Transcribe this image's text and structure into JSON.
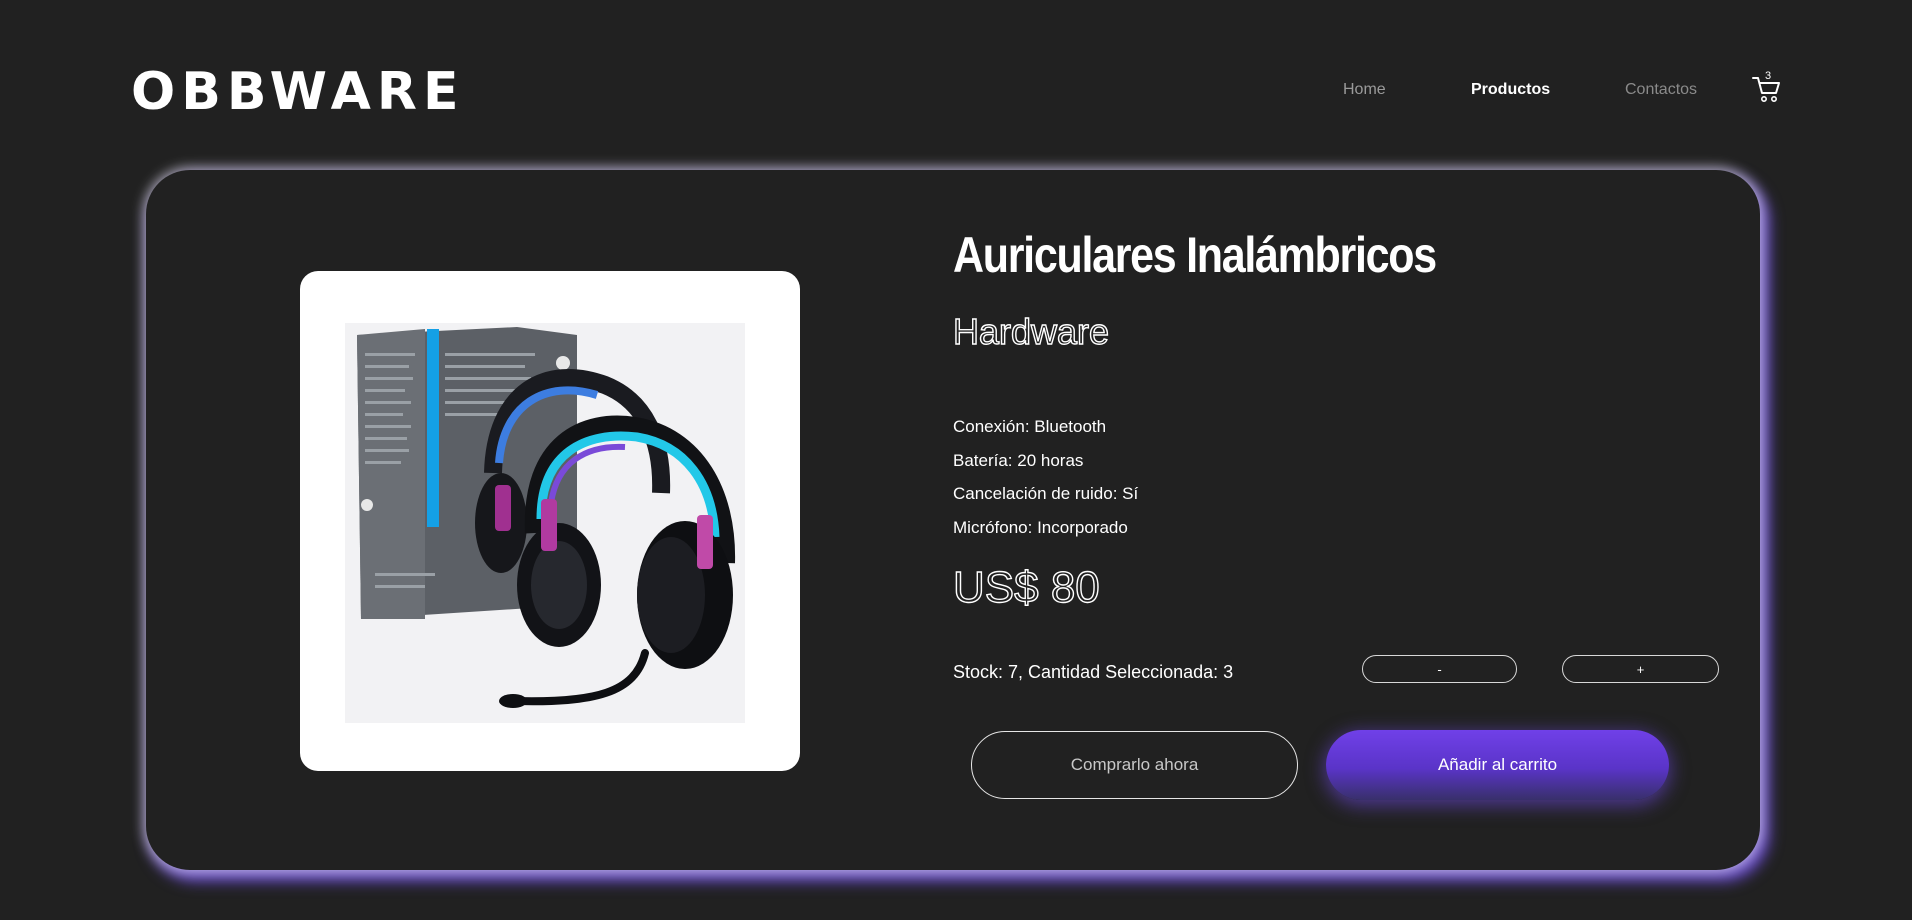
{
  "header": {
    "logo": "OBBWARE",
    "nav": [
      {
        "label": "Home"
      },
      {
        "label": "Productos"
      },
      {
        "label": "Contactos"
      }
    ],
    "cart_count": "3"
  },
  "product": {
    "title": "Auriculares Inalámbricos",
    "category": "Hardware",
    "specs": [
      "Conexión: Bluetooth",
      "Batería: 20 horas",
      "Cancelación de ruido: Sí",
      "Micrófono: Incorporado"
    ],
    "price": "US$ 80",
    "stock_text": "Stock: 7, Cantidad Seleccionada: 3",
    "qty_minus_label": "-",
    "qty_plus_label": "+",
    "buy_now_label": "Comprarlo ahora",
    "add_to_cart_label": "Añadir al carrito"
  },
  "colors": {
    "background": "#212121",
    "accent": "#6a44e0",
    "card_glow": "#7050e0"
  },
  "icons": {
    "cart": "cart-icon",
    "product_image": "headset-image"
  }
}
